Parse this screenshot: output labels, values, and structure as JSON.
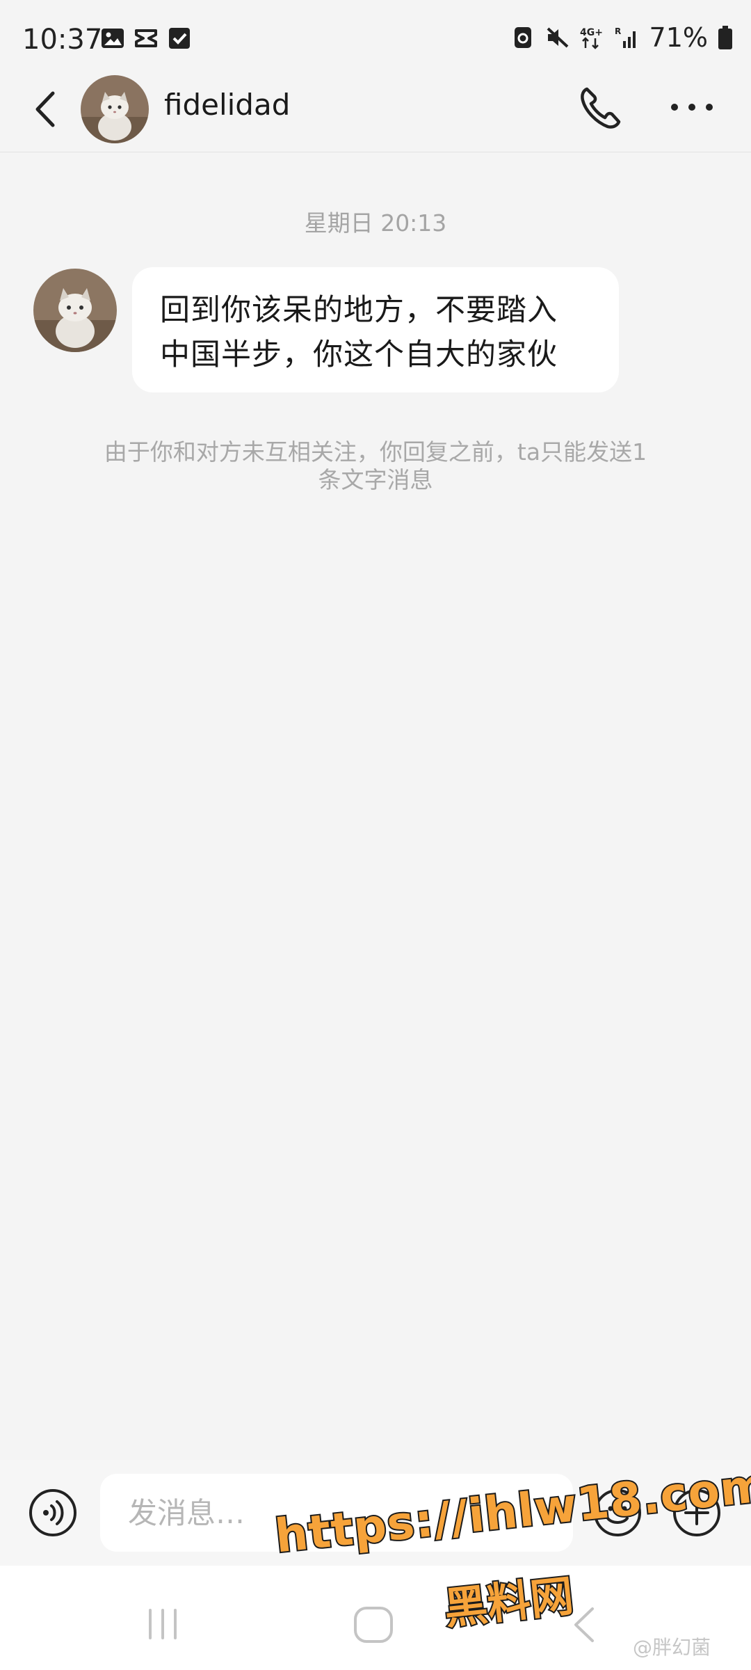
{
  "status_bar": {
    "time": "10:37",
    "battery_text": "71%",
    "left_icons": [
      "gallery-icon",
      "capcut-icon",
      "checkbox-icon"
    ],
    "right_icons": [
      "data-saver-icon",
      "mute-icon",
      "4g-icon",
      "signal-icon",
      "battery-icon"
    ]
  },
  "header": {
    "contact_name": "fidelidad",
    "icons": [
      "back-arrow-icon",
      "phone-icon",
      "more-icon"
    ]
  },
  "chat": {
    "timestamp": "星期日 20:13",
    "messages": [
      {
        "lines": [
          "回到你该呆的地方，不要踏入",
          "中国半步，你这个自大的家伙"
        ]
      }
    ],
    "notice_line1": "由于你和对方未互相关注，你回复之前，ta只能发送1",
    "notice_line2": "条文字消息"
  },
  "input_bar": {
    "placeholder": "发消息…",
    "icons": [
      "voice-icon",
      "emoji-icon",
      "plus-icon"
    ]
  },
  "watermark": {
    "url": "https://ihlw18.com",
    "subtitle": "黑料网",
    "weibo": "@胖幻菌"
  },
  "colors": {
    "background": "#f4f4f4",
    "bubble": "#ffffff",
    "muted_text": "#a4a4a4",
    "watermark_orange": "#f6a33a"
  }
}
